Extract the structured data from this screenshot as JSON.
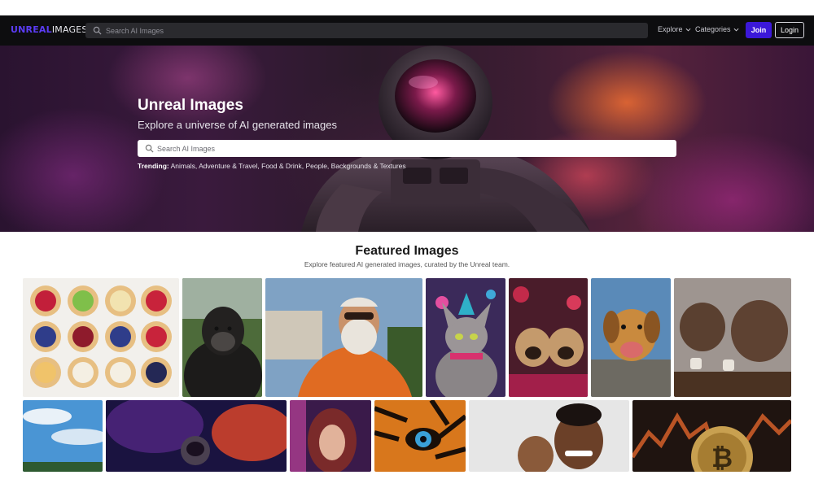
{
  "header": {
    "logo_primary": "UNREAL",
    "logo_secondary": "IMAGES",
    "search_placeholder": "Search AI Images",
    "nav": [
      {
        "label": "Explore"
      },
      {
        "label": "Categories"
      }
    ],
    "join_label": "Join",
    "login_label": "Login",
    "colors": {
      "brand": "#5b3cf5",
      "join_bg": "#3b18d9",
      "bar_bg": "#0d0d0f"
    }
  },
  "hero": {
    "title": "Unreal Images",
    "subtitle": "Explore a universe of AI generated images",
    "search_placeholder": "Search AI Images",
    "trending_label": "Trending:",
    "trending_items": "Animals, Adventure & Travel, Food & Drink, People, Backgrounds & Textures"
  },
  "featured": {
    "title": "Featured Images",
    "subtitle": "Explore featured AI generated images, curated by the Unreal team.",
    "images": [
      {
        "subject": "tartlets"
      },
      {
        "subject": "gorilla"
      },
      {
        "subject": "old-man-sunglasses"
      },
      {
        "subject": "sphynx-cat-party-hat"
      },
      {
        "subject": "pugs"
      },
      {
        "subject": "dog-smiling"
      },
      {
        "subject": "bears-coffee"
      },
      {
        "subject": "beach-sky"
      },
      {
        "subject": "astronaut-nebula"
      },
      {
        "subject": "neon-woman"
      },
      {
        "subject": "tiger-eye"
      },
      {
        "subject": "father-and-baby"
      },
      {
        "subject": "bitcoin-coin"
      }
    ]
  }
}
